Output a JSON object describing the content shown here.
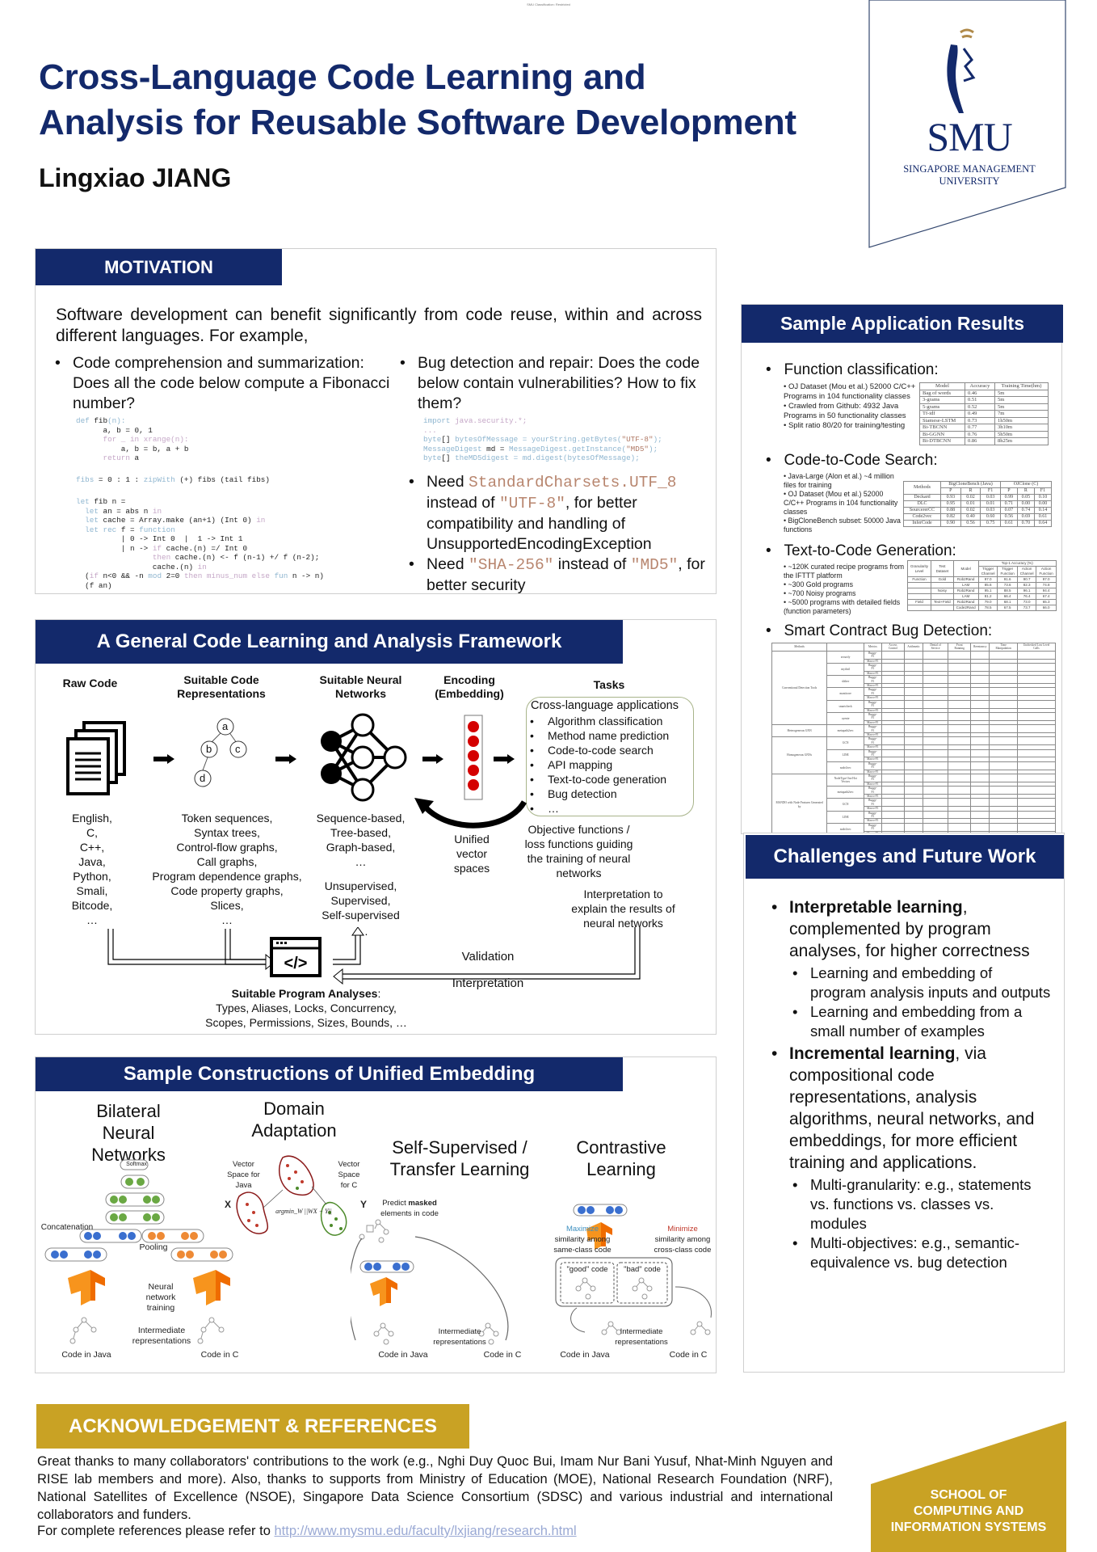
{
  "classification": "SMU Classification: Restricted",
  "header": {
    "title_line1": "Cross-Language Code Learning and",
    "title_line2": "Analysis for Reusable Software Development",
    "author": "Lingxiao JIANG",
    "logo": {
      "name": "SMU",
      "subtitle_line1": "SINGAPORE MANAGEMENT",
      "subtitle_line2": "UNIVERSITY"
    }
  },
  "colors": {
    "navy": "#13296b",
    "gold": "#c9a224",
    "code_red": "#b8866f",
    "embedding_red": "#d40000"
  },
  "motivation": {
    "heading": "MOTIVATION",
    "intro": "Software development can benefit significantly from code reuse, within and across different languages. For example,",
    "left_bullet": "Code comprehension and summarization: Does all the code below compute a Fibonacci number?",
    "right_bullet": "Bug detection and repair: Does the code below contain vulnerabilities? How to fix them?",
    "fix1_pre": "Need ",
    "fix1_code": "StandardCharsets.UTF_8",
    "fix1_mid": " instead of ",
    "fix1_code2": "\"UTF-8\"",
    "fix1_post": ", for better compatibility and handling of UnsupportedEncodingException",
    "fix2_pre": "Need ",
    "fix2_code": "\"SHA-256\"",
    "fix2_mid": " instead of ",
    "fix2_code2": "\"MD5\"",
    "fix2_post": ", for better security"
  },
  "framework": {
    "heading": "A General Code Learning and Analysis Framework",
    "col_raw": "Raw Code",
    "col_repr": "Suitable Code Representations",
    "col_nn": "Suitable Neural Networks",
    "col_enc": "Encoding (Embedding)",
    "col_tasks": "Tasks",
    "tree_nodes": [
      "a",
      "b",
      "c",
      "d"
    ],
    "tasks_title": "Cross-language applications",
    "tasks": [
      "Algorithm classification",
      "Method name prediction",
      "Code-to-code search",
      "API mapping",
      "Text-to-code generation",
      "Bug detection",
      "…"
    ],
    "languages": [
      "English,",
      "C,",
      "C++,",
      "Java,",
      "Python,",
      "Smali,",
      "Bitcode,",
      "…"
    ],
    "representations": [
      "Token sequences,",
      "Syntax trees,",
      "Control-flow graphs,",
      "Call graphs,",
      "Program dependence graphs,",
      "Code property graphs,",
      "Slices,",
      "…"
    ],
    "nn_types": [
      "Sequence-based,",
      "Tree-based,",
      "Graph-based,",
      "…"
    ],
    "nn_learning": [
      "Unsupervised,",
      "Supervised,",
      "Self-supervised"
    ],
    "nn_more": "…",
    "unified": "Unified vector spaces",
    "objective": "Objective functions / loss functions guiding the training of neural networks",
    "interpretation_to": "Interpretation to explain the results of neural networks",
    "validation": "Validation",
    "interpretation": "Interpretation",
    "analyses_title": "Suitable Program Analyses",
    "analyses_line1": "Types, Aliases, Locks, Concurrency,",
    "analyses_line2": "Scopes, Permissions, Sizes, Bounds, …"
  },
  "constructions": {
    "heading": "Sample Constructions of Unified Embedding",
    "bilateral": {
      "title": "Bilateral Neural Networks",
      "softmax": "Softmax",
      "concatenation": "Concatenation",
      "pooling": "Pooling",
      "training": "Neural network training",
      "intermediate": "Intermediate representations",
      "code_java": "Code in Java",
      "code_c": "Code in C"
    },
    "domain": {
      "title": "Domain Adaptation",
      "space_java": "Vector Space for Java",
      "space_c": "Vector Space for C",
      "x": "X",
      "y": "Y",
      "formula": "argmin_W ||WX − Y||"
    },
    "self_supervised": {
      "title": "Self-Supervised / Transfer Learning",
      "predict_pre": "Predict ",
      "predict_bold": "masked",
      "predict_post": " elements in code",
      "intermediate": "Intermediate representations",
      "code_java": "Code in Java",
      "code_c": "Code in C"
    },
    "contrastive": {
      "title": "Contrastive Learning",
      "maximize": "Maximize",
      "maximize_desc": "similarity among same-class code",
      "minimize": "Minimize",
      "minimize_desc": "similarity among cross-class code",
      "good": "\"good\" code",
      "bad": "\"bad\" code",
      "intermediate": "Intermediate representations",
      "code_java": "Code in Java",
      "code_c": "Code in C"
    }
  },
  "results": {
    "heading": "Sample Application Results",
    "function_classification": {
      "title": "Function classification:",
      "notes": [
        "OJ Dataset (Mou et al.) 52000 C/C++ Programs in 104 functionality classes",
        "Crawled from Github: 4932 Java Programs in 50 functionality classes",
        "Split ratio 80/20 for training/testing"
      ],
      "columns": [
        "Model",
        "Accuracy",
        "Training Time(hm)"
      ],
      "rows": [
        [
          "Bag of words",
          "0.46",
          "5m"
        ],
        [
          "3-grams",
          "0.51",
          "5m"
        ],
        [
          "5-grams",
          "0.52",
          "5m"
        ],
        [
          "Tf-idf",
          "0.49",
          "7m"
        ],
        [
          "Siamese-LSTM",
          "0.73",
          "1h50m"
        ],
        [
          "Bi-TBCNN",
          "0.77",
          "3h10m"
        ],
        [
          "Bi-GGNN",
          "0.76",
          "5h50m"
        ],
        [
          "Bi-DTBCNN",
          "0.86",
          "8h25m"
        ]
      ]
    },
    "code_search": {
      "title": "Code-to-Code Search:",
      "notes": [
        "Java-Large (Alon et al.) ~4 million files for training",
        "OJ Dataset (Mou et al.) 52000 C/C++ Programs in 104 functionality classes",
        "BigCloneBench subset: 50000 Java functions"
      ],
      "group_headers": [
        "Methods",
        "BigCloneBench (Java)",
        "OJClone (C)"
      ],
      "sub_headers": [
        "P",
        "R",
        "F1",
        "P",
        "R",
        "F1"
      ],
      "rows": [
        [
          "Deckard",
          "0.93",
          "0.02",
          "0.03",
          "0.99",
          "0.05",
          "0.10"
        ],
        [
          "DLC",
          "0.95",
          "0.01",
          "0.01",
          "0.71",
          "0.00",
          "0.00"
        ],
        [
          "SourcererCC",
          "0.88",
          "0.02",
          "0.03",
          "0.07",
          "0.74",
          "0.14"
        ],
        [
          "Code2vec",
          "0.82",
          "0.40",
          "0.60",
          "0.56",
          "0.69",
          "0.61"
        ],
        [
          "InferCode",
          "0.90",
          "0.56",
          "0.75",
          "0.61",
          "0.70",
          "0.64"
        ]
      ]
    },
    "text_to_code": {
      "title": "Text-to-Code Generation:",
      "notes": [
        "~120K curated recipe programs from the IFTTT platform",
        "~300 Gold programs",
        "~700 Noisy programs",
        "~5000 programs with detailed fields (function parameters)"
      ],
      "headers": [
        "Granularity Level",
        "Test Dataset",
        "Model",
        "Trigger Channel",
        "Trigger Function",
        "Action Channel",
        "Action Function"
      ],
      "super_header": "Top-1 Accuracy (%)",
      "rows": [
        [
          "Function",
          "Gold",
          "Rob2Rand",
          "97.0",
          "91.6",
          "90.7",
          "97.0"
        ],
        [
          "",
          "",
          "LAM",
          "85.6",
          "73.6",
          "82.3",
          "74.8"
        ],
        [
          "",
          "Noisy",
          "Rob2Rand",
          "95.1",
          "88.5",
          "96.1",
          "94.4"
        ],
        [
          "",
          "",
          "LAM",
          "81.2",
          "66.4",
          "76.4",
          "67.4"
        ],
        [
          "Field",
          "Text+Field",
          "Rob2Rand",
          "79.0",
          "68.1",
          "73.0",
          "65.3"
        ],
        [
          "",
          "",
          "Code2Rand",
          "78.5",
          "67.5",
          "73.7",
          "66.0"
        ]
      ]
    },
    "smart_contract": {
      "title": "Smart Contract Bug Detection:",
      "headers": [
        "Methods",
        "",
        "Metrics",
        "Access Control",
        "Arithmetic",
        "Denial of Service",
        "Front Running",
        "Reentrancy",
        "Time Manipulation",
        "Unchecked Low Level Calls"
      ],
      "groups": [
        {
          "name": "Conventional Detection Tools",
          "methods": [
            "securify",
            "mythril",
            "slither",
            "manticore",
            "smartcheck",
            "oyente"
          ]
        },
        {
          "name": "Heterogeneous GNN",
          "methods": [
            "metapath2vec"
          ]
        },
        {
          "name": "Homogeneous GNNs",
          "methods": [
            "GCN",
            "LINE",
            "node2vec"
          ]
        },
        {
          "name": "MANDO with Node Features Generated by",
          "methods": [
            "NodeType One Hot Vectors",
            "metapath2vec",
            "GCN",
            "LINE",
            "node2vec"
          ]
        }
      ],
      "metrics": [
        "Buggy-F1",
        "Macro-F1"
      ]
    }
  },
  "challenges": {
    "heading": "Challenges and Future Work",
    "items": [
      {
        "bold": "Interpretable learning",
        "text": ", complemented by program analyses, for higher correctness",
        "sub": [
          "Learning and embedding of program analysis inputs and outputs",
          "Learning and embedding from a small number of examples"
        ]
      },
      {
        "bold": "Incremental learning",
        "text": ", via compositional code representations, analysis algorithms, neural networks, and embeddings, for more efficient training and applications.",
        "sub": [
          "Multi-granularity: e.g., statements vs. functions vs. classes vs. modules",
          "Multi-objectives: e.g., semantic-equivalence vs. bug detection"
        ]
      }
    ]
  },
  "acknowledgement": {
    "heading": "ACKNOWLEDGEMENT & REFERENCES",
    "text": "Great thanks to many collaborators' contributions to the work (e.g., Nghi Duy Quoc Bui, Imam Nur Bani Yusuf, Nhat-Minh Nguyen and RISE lab members and more). Also, thanks to supports from Ministry of Education (MOE), National Research Foundation (NRF), National Satellites of Excellence (NSOE), Singapore Data Science Consortium (SDSC) and various industrial and international collaborators and funders.",
    "ref_prefix": "For complete references please refer to ",
    "ref_link": "http://www.mysmu.edu/faculty/lxjiang/research.html"
  },
  "school_badge": {
    "line1": "SCHOOL OF",
    "line2": "COMPUTING AND",
    "line3": "INFORMATION SYSTEMS"
  }
}
